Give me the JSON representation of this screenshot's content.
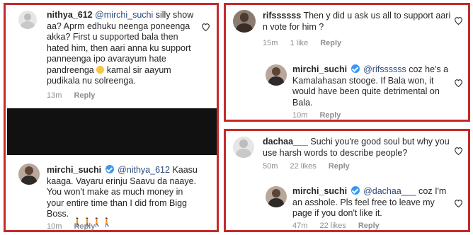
{
  "panels": {
    "left": {
      "comment1": {
        "username": "nithya_612",
        "mention": "@mirchi_suchi",
        "text": "silly show aa? Aprm edhuku neenga poneenga akka? First u supported bala then hated him, then aari anna ku support panneenga ipo avarayum hate pandreenga",
        "text_after_emoji": "kamal sir aayum pudikala nu solreenga.",
        "emoji": "grinning-sweat-emoji",
        "time": "13m",
        "reply_label": "Reply"
      },
      "comment2": {
        "username": "mirchi_suchi",
        "mention": "@nithya_612",
        "text": "Kaasu kaaga. Vayaru erinju Saavu da naaye. You won't make as much money in your entire time than I did from Bigg Boss.",
        "time": "10m",
        "reply_label": "Reply"
      }
    },
    "top_right": {
      "comment1": {
        "username": "rifssssss",
        "text": "Then y did u ask us all to support aari n vote for him ?",
        "time": "15m",
        "likes": "1 like",
        "reply_label": "Reply"
      },
      "comment2": {
        "username": "mirchi_suchi",
        "mention": "@rifssssss",
        "text": "coz he's a Kamalahasan stooge. If Bala won, it would have been quite detrimental on Bala.",
        "time": "10m",
        "reply_label": "Reply"
      }
    },
    "bottom_right": {
      "comment1": {
        "username": "dachaa___",
        "text": "Suchi you're good soul but why you use harsh words to describe people?",
        "time": "50m",
        "likes": "22 likes",
        "reply_label": "Reply"
      },
      "comment2": {
        "username": "mirchi_suchi",
        "mention": "@dachaa___",
        "text": "coz I'm an asshole. Pls feel free to leave my page if you don't like it.",
        "time": "47m",
        "likes": "22 likes",
        "reply_label": "Reply"
      }
    }
  },
  "colors": {
    "panel_border": "#c42a2a",
    "verified": "#3897f0",
    "meta_text": "#8e8e8e",
    "redaction": "#111111"
  }
}
